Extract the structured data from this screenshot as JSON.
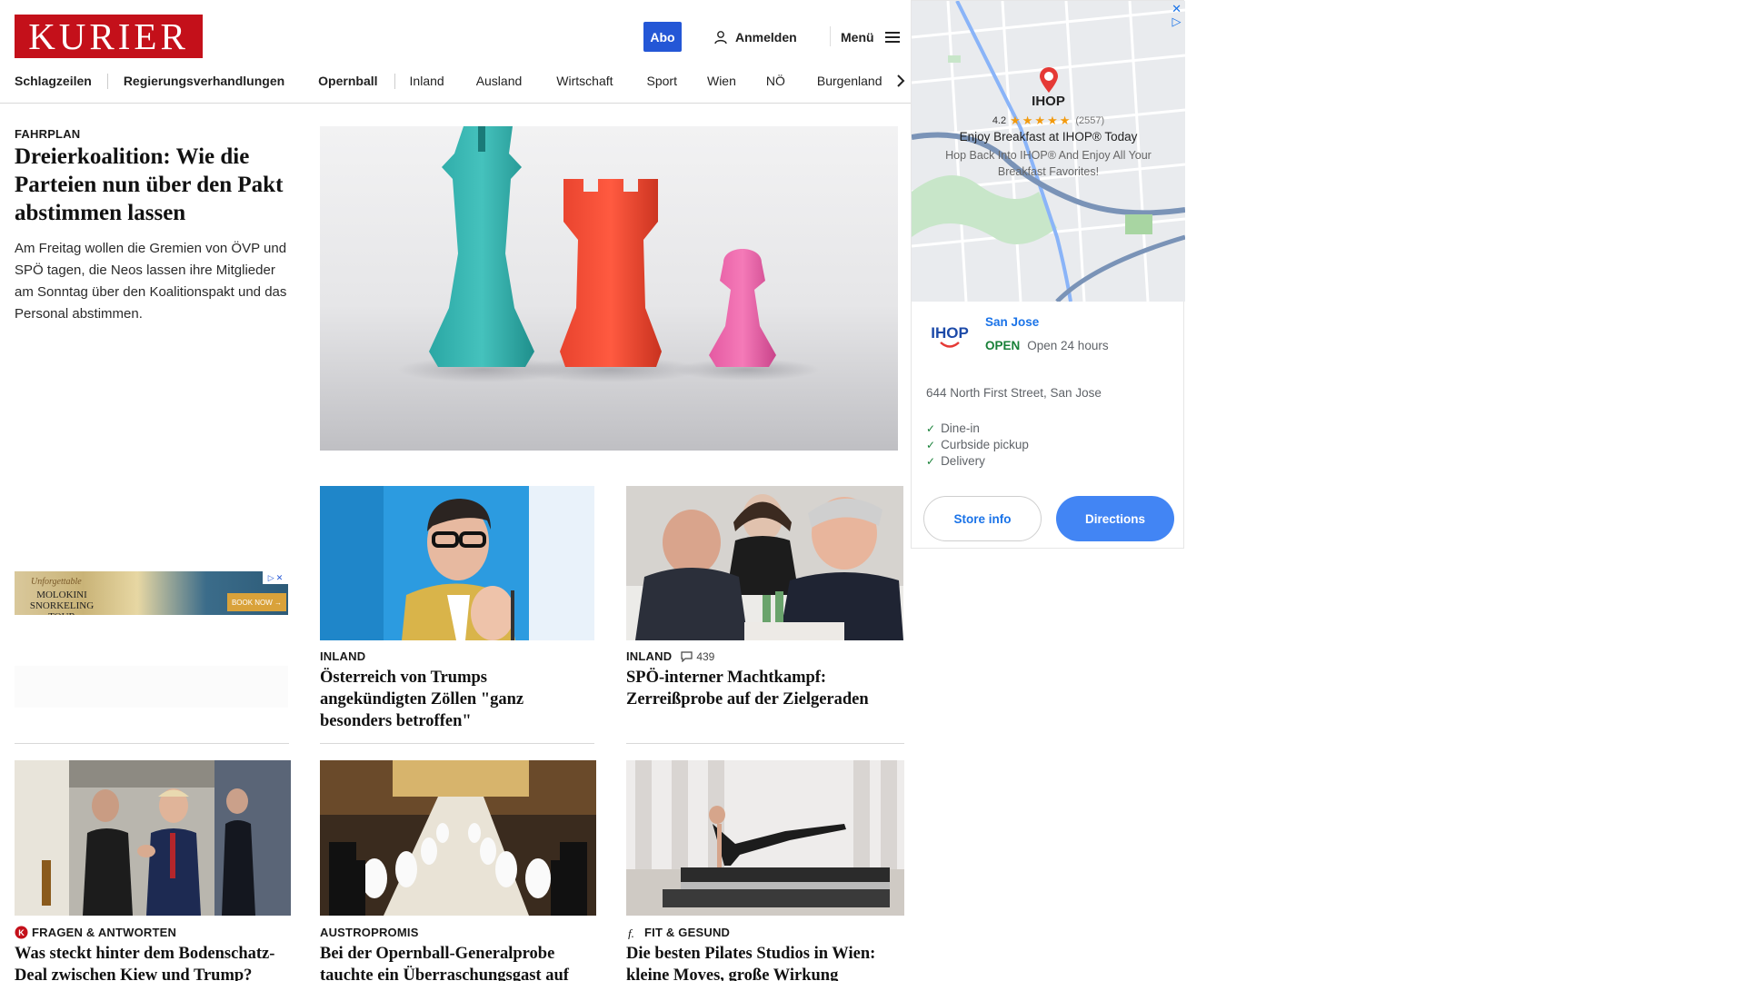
{
  "header": {
    "logo": "KURIER",
    "abo_label": "Abo",
    "login_label": "Anmelden",
    "menu_label": "Menü"
  },
  "nav": {
    "items": [
      "Schlagzeilen",
      "Regierungsverhandlungen",
      "Opernball",
      "Inland",
      "Ausland",
      "Wirtschaft",
      "Sport",
      "Wien",
      "NÖ",
      "Burgenland"
    ]
  },
  "lead": {
    "kicker": "FAHRPLAN",
    "title": "Dreierkoalition: Wie die Parteien nun über den Pakt abstimmen lassen",
    "teaser": "Am Freitag wollen die Gremien von ÖVP und SPÖ tagen, die Neos lassen ihre Mitglieder am Sonntag über den Koalitionspakt und das Personal abstimmen."
  },
  "cards": [
    {
      "kicker": "INLAND",
      "comments": "",
      "title": "Österreich von Trumps angekündigten Zöllen \"ganz besonders betroffen\""
    },
    {
      "kicker": "INLAND",
      "comments": "439",
      "title": "SPÖ-interner Machtkampf: Zerreißprobe auf der Zielgeraden"
    },
    {
      "kicker": "FRAGEN & ANTWORTEN",
      "comments": "",
      "title": "Was steckt hinter dem Bodenschatz-Deal zwischen Kiew und Trump?"
    },
    {
      "kicker": "AUSTROPROMIS",
      "comments": "",
      "title": "Bei der Opernball-Generalprobe tauchte ein Überraschungsgast auf"
    },
    {
      "kicker": "FIT & GESUND",
      "comments": "",
      "title": "Die besten Pilates Studios in Wien: kleine Moves, große Wirkung"
    }
  ],
  "left_ad": {
    "script": "Unforgettable",
    "name": "MOLOKINI SNORKELING TOUR",
    "cta": "BOOK NOW →"
  },
  "map_ad": {
    "poi_name": "IHOP",
    "rating": "4.2",
    "stars": "★★★★★",
    "rating_count": "(2557)",
    "headline": "Enjoy Breakfast at IHOP® Today",
    "description": "Hop Back Into IHOP® And Enjoy All Your Breakfast Favorites!",
    "brand": "IHOP",
    "city": "San Jose",
    "status": "OPEN",
    "hours": "Open 24 hours",
    "address": "644 North First Street, San Jose",
    "features": [
      "Dine-in",
      "Curbside pickup",
      "Delivery"
    ],
    "store_info_label": "Store info",
    "directions_label": "Directions"
  }
}
